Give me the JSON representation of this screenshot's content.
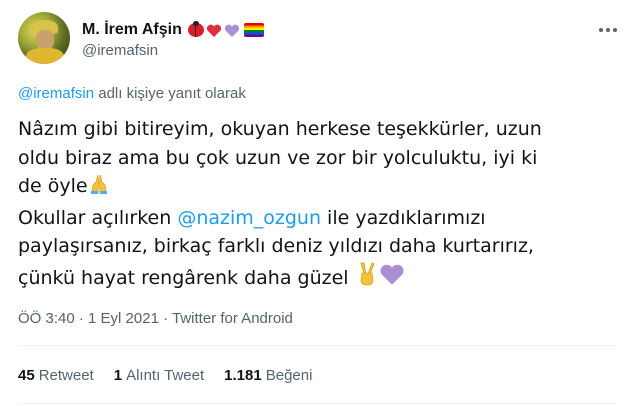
{
  "author": {
    "display_name": "M. İrem Afşin",
    "handle": "@iremafsin",
    "name_emojis": [
      "ladybug-icon",
      "red-heart-icon",
      "purple-heart-icon",
      "rainbow-flag-icon"
    ]
  },
  "reply": {
    "mention": "@iremafsin",
    "suffix": " adlı kişiye yanıt olarak"
  },
  "tweet": {
    "line1": "Nâzım gibi bitireyim, okuyan herkese teşekkürler, uzun",
    "line2": "oldu biraz ama bu çok uzun ve zor bir yolculuktu, iyi ki",
    "line3": "de öyle",
    "line4_prefix": "Okullar açılırken ",
    "line4_mention": "@nazim_ozgun",
    "line4_suffix": " ile yazdıklarımızı",
    "line5": "paylaşırsanız, birkaç farklı deniz yıldızı daha kurtarırız,",
    "line6": "çünkü hayat rengârenk daha güzel "
  },
  "meta": {
    "time": "ÖÖ 3:40",
    "sep1": " · ",
    "date": "1 Eyl 2021",
    "sep2": " · ",
    "source": "Twitter for Android"
  },
  "stats": {
    "retweets_count": "45",
    "retweets_label": "Retweet",
    "quotes_count": "1",
    "quotes_label": "Alıntı Tweet",
    "likes_count": "1.181",
    "likes_label": "Beğeni"
  },
  "colors": {
    "link": "#1d9bf0",
    "secondary_text": "#536471",
    "primary_text": "#0f1419"
  }
}
